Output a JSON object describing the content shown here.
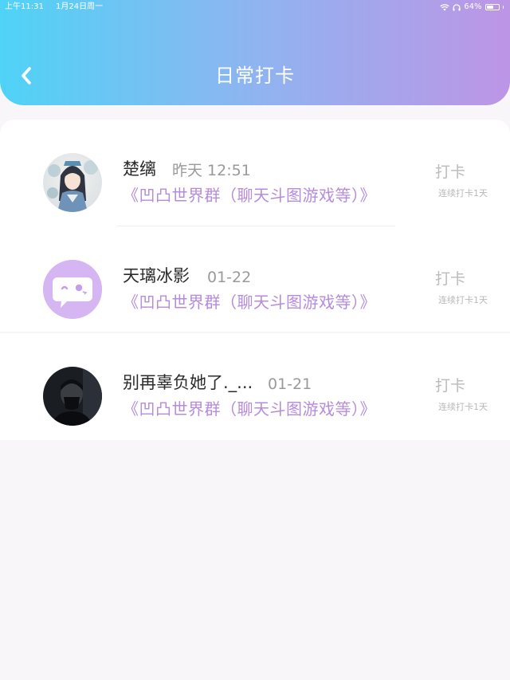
{
  "status_bar": {
    "time": "上午11:31",
    "date": "1月24日周一",
    "battery": "64%",
    "battery_level": 0.64
  },
  "header": {
    "title": "日常打卡",
    "back_icon": "chevron-left-icon"
  },
  "colors": {
    "gradient_start": "#4fd3f6",
    "gradient_end": "#bd95e6",
    "group_text": "#b58bdc"
  },
  "records": [
    {
      "name": "楚缡",
      "time": "昨天 12:51",
      "group": "《凹凸世界群（聊天斗图游戏等）》",
      "action": "打卡",
      "streak": "连续打卡1天",
      "avatar": "anime-girl-avatar"
    },
    {
      "name": "天璃冰影",
      "time": "01-22",
      "group": "《凹凸世界群（聊天斗图游戏等）》",
      "action": "打卡",
      "streak": "连续打卡1天",
      "avatar": "default-chat-avatar"
    },
    {
      "name": "别再辜负她了._...",
      "time": "01-21",
      "group": "《凹凸世界群（聊天斗图游戏等）》",
      "action": "打卡",
      "streak": "连续打卡1天",
      "avatar": "dark-photo-avatar"
    }
  ]
}
